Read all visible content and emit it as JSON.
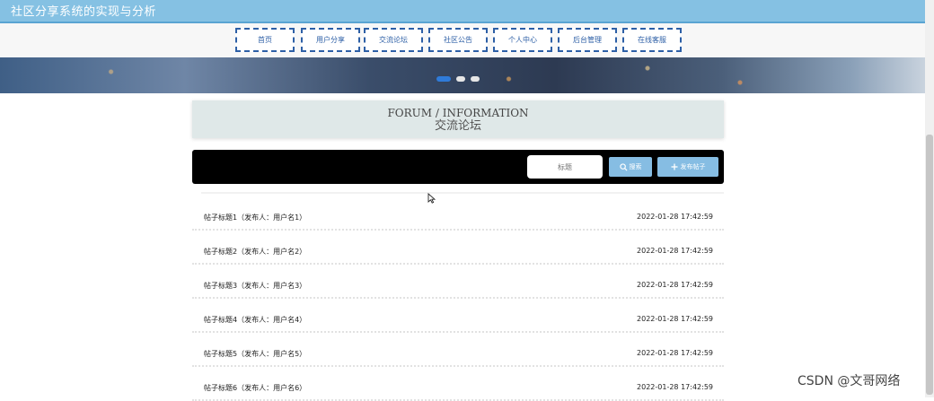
{
  "app": {
    "title": "社区分享系统的实现与分析"
  },
  "nav": {
    "items": [
      {
        "label": "首页"
      },
      {
        "label": "用户分享"
      },
      {
        "label": "交流论坛"
      },
      {
        "label": "社区公告"
      },
      {
        "label": "个人中心"
      },
      {
        "label": "后台管理"
      },
      {
        "label": "在线客服"
      }
    ]
  },
  "banner": {
    "slides": 3,
    "active_slide": 1
  },
  "forum": {
    "title_en": "FORUM / INFORMATION",
    "title_cn": "交流论坛"
  },
  "search": {
    "placeholder": "标题",
    "search_label": "搜索",
    "post_label": "发布帖子"
  },
  "posts": [
    {
      "title": "帖子标题1（发布人：用户名1）",
      "time": "2022-01-28 17:42:59"
    },
    {
      "title": "帖子标题2（发布人：用户名2）",
      "time": "2022-01-28 17:42:59"
    },
    {
      "title": "帖子标题3（发布人：用户名3）",
      "time": "2022-01-28 17:42:59"
    },
    {
      "title": "帖子标题4（发布人：用户名4）",
      "time": "2022-01-28 17:42:59"
    },
    {
      "title": "帖子标题5（发布人：用户名5）",
      "time": "2022-01-28 17:42:59"
    },
    {
      "title": "帖子标题6（发布人：用户名6）",
      "time": "2022-01-28 17:42:59"
    }
  ],
  "watermark": "CSDN @文哥网络",
  "colors": {
    "header": "#85c1e3",
    "nav_border": "#2d5fa6",
    "button": "#86bde3",
    "forum_header_bg": "#dfe8e8"
  }
}
